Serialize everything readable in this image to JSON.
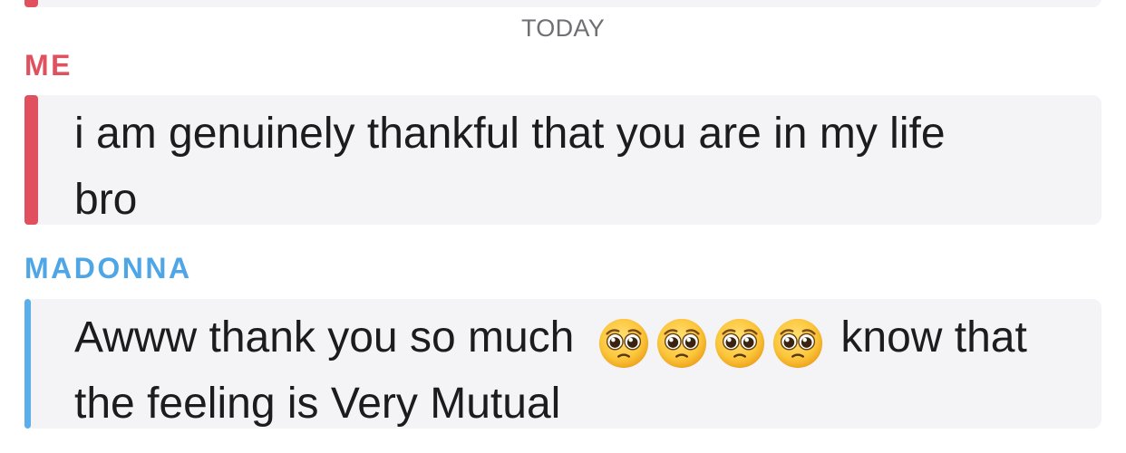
{
  "date_separator": "TODAY",
  "messages": [
    {
      "sender": "ME",
      "lines": [
        "i am genuinely thankful that you are in my life",
        "bro"
      ],
      "accent": "#e0505f"
    },
    {
      "sender": "MADONNA",
      "line1_start": "Awww thank you so much",
      "emoji_icon": "pleading-face-icon",
      "emoji_count": 4,
      "line1_end": "know that",
      "line2": "the feeling is Very Mutual",
      "accent": "#4ea6e6"
    }
  ],
  "colors": {
    "bubble_bg": "#f4f4f7",
    "text": "#1c1c1e",
    "date_text": "#6f6f74"
  }
}
